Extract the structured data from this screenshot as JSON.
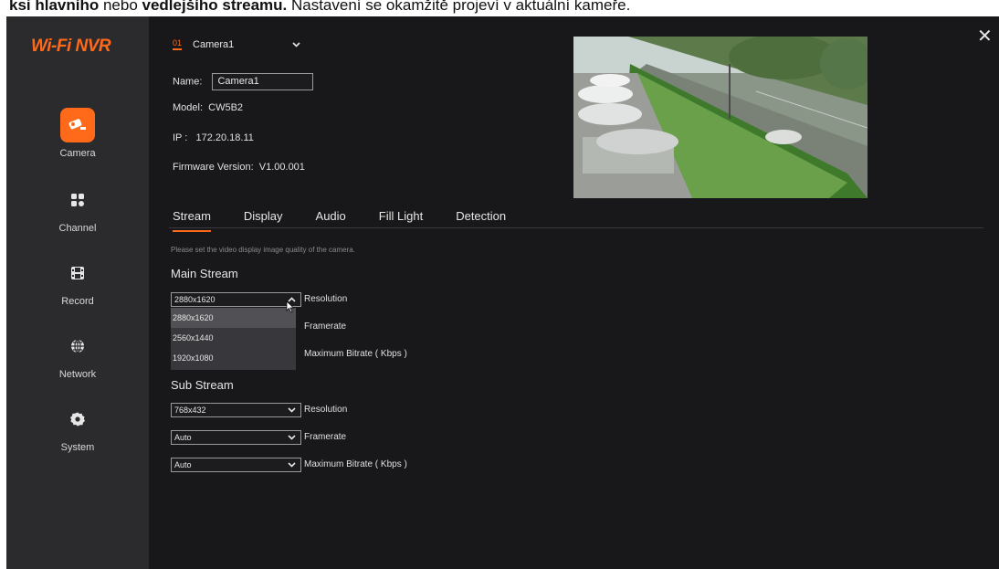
{
  "caption": {
    "bold1": "ksi hlavního",
    "mid": " nebo ",
    "bold2": "vedlejšího streamu.",
    "rest": " Nastavení se okamžitě projeví v aktuální kameře."
  },
  "app": {
    "logo": "Wi-Fi NVR"
  },
  "nav": [
    {
      "label": "Camera",
      "icon": "camera-icon"
    },
    {
      "label": "Channel",
      "icon": "channel-grid-icon"
    },
    {
      "label": "Record",
      "icon": "film-icon"
    },
    {
      "label": "Network",
      "icon": "globe-icon"
    },
    {
      "label": "System",
      "icon": "gear-icon"
    }
  ],
  "camera_selector": {
    "number": "01",
    "name": "Camera1"
  },
  "info": {
    "name_label": "Name:",
    "name_value": "Camera1",
    "model_label": "Model:",
    "model_value": "CW5B2",
    "ip_label": "IP :",
    "ip_value": "172.20.18.11",
    "firmware_label": "Firmware Version:",
    "firmware_value": "V1.00.001"
  },
  "tabs": [
    "Stream",
    "Display",
    "Audio",
    "Fill Light",
    "Detection"
  ],
  "hint": "Please set the video display image quality of the camera.",
  "main_stream": {
    "title": "Main Stream",
    "resolution_value": "2880x1620",
    "resolution_label": "Resolution",
    "framerate_label": "Framerate",
    "bitrate_label": "Maximum Bitrate ( Kbps )",
    "options": [
      "2880x1620",
      "2560x1440",
      "1920x1080"
    ]
  },
  "sub_stream": {
    "title": "Sub Stream",
    "resolution_value": "768x432",
    "resolution_label": "Resolution",
    "framerate_value": "Auto",
    "framerate_label": "Framerate",
    "bitrate_value": "Auto",
    "bitrate_label": "Maximum Bitrate ( Kbps )"
  },
  "colors": {
    "accent": "#ff6a1a",
    "background": "#18181b",
    "sidebar": "#2b2b2e"
  }
}
